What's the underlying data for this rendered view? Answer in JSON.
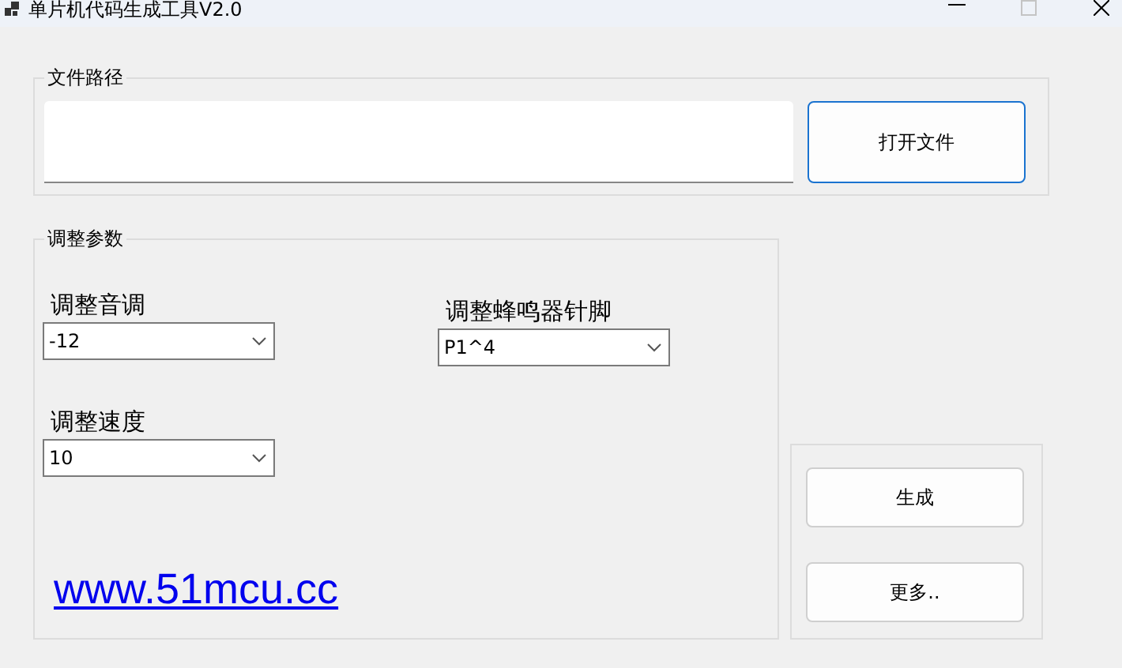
{
  "window": {
    "title": "单片机代码生成工具V2.0",
    "maximize_disabled": true
  },
  "file_group": {
    "legend": "文件路径",
    "open_button": "打开文件"
  },
  "params_group": {
    "legend": "调整参数",
    "combos": [
      {
        "label": "调整音调",
        "value": "-12"
      },
      {
        "label": "调整蜂鸣器针脚",
        "value": "P1^4"
      },
      {
        "label": "调整速度",
        "value": "10"
      }
    ],
    "link": "www.51mcu.cc"
  },
  "actions": [
    "生成",
    "更多.."
  ]
}
